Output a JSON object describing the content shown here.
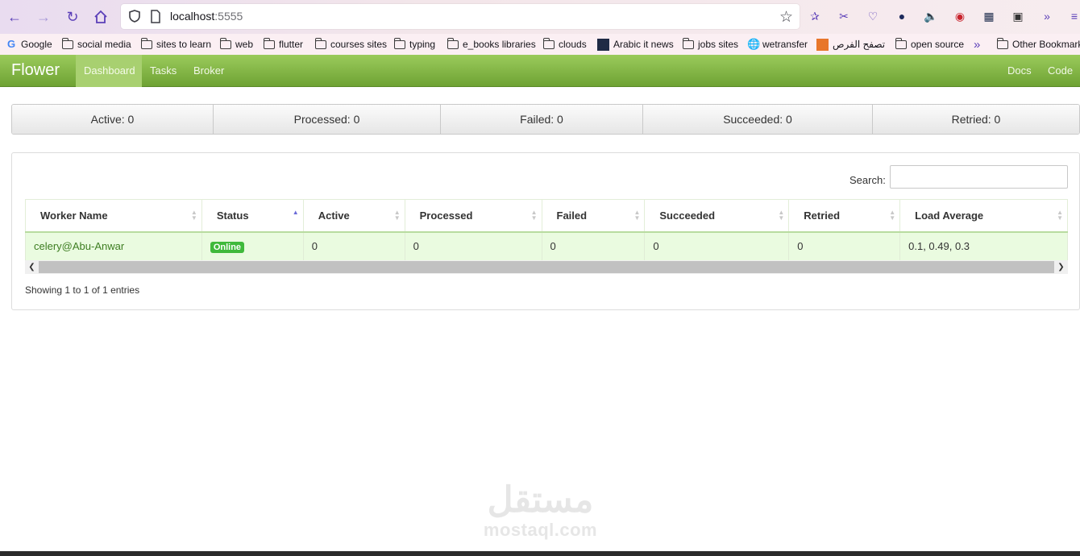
{
  "browser": {
    "url_host": "localhost",
    "url_port": ":5555",
    "bookmarks": [
      {
        "label": "Google",
        "icon": "google-icon"
      },
      {
        "label": "social media",
        "icon": "folder-icon"
      },
      {
        "label": "sites to learn",
        "icon": "folder-icon"
      },
      {
        "label": "web",
        "icon": "folder-icon"
      },
      {
        "label": "flutter",
        "icon": "folder-icon"
      },
      {
        "label": "courses sites",
        "icon": "folder-icon"
      },
      {
        "label": "typing",
        "icon": "folder-icon"
      },
      {
        "label": "e_books libraries",
        "icon": "folder-icon"
      },
      {
        "label": "clouds",
        "icon": "folder-icon"
      },
      {
        "label": "Arabic it news",
        "icon": "site-icon"
      },
      {
        "label": "jobs sites",
        "icon": "folder-icon"
      },
      {
        "label": "wetransfer",
        "icon": "globe-icon"
      },
      {
        "label": "تصفح الفرص",
        "icon": "site-icon"
      },
      {
        "label": "open source",
        "icon": "folder-icon"
      }
    ],
    "other_bookmarks": "Other Bookmarks"
  },
  "navbar": {
    "brand": "Flower",
    "items": [
      "Dashboard",
      "Tasks",
      "Broker"
    ],
    "active": "Dashboard",
    "right_items": [
      "Docs",
      "Code"
    ]
  },
  "stats": [
    {
      "label": "Active: 0"
    },
    {
      "label": "Processed: 0"
    },
    {
      "label": "Failed: 0"
    },
    {
      "label": "Succeeded: 0"
    },
    {
      "label": "Retried: 0"
    }
  ],
  "workers": {
    "search_label": "Search:",
    "search_value": "",
    "columns": [
      "Worker Name",
      "Status",
      "Active",
      "Processed",
      "Failed",
      "Succeeded",
      "Retried",
      "Load Average"
    ],
    "sorted_column": "Status",
    "rows": [
      {
        "worker_name": "celery@Abu-Anwar",
        "status": "Online",
        "active": "0",
        "processed": "0",
        "failed": "0",
        "succeeded": "0",
        "retried": "0",
        "load_average": "0.1, 0.49, 0.3"
      }
    ],
    "info": "Showing 1 to 1 of 1 entries"
  },
  "watermark": {
    "arabic": "مستقل",
    "latin": "mostaql.com"
  },
  "colors": {
    "navbar_top": "#9bcb5c",
    "navbar_bottom": "#6ea233",
    "row_bg": "#eafbe0",
    "online_badge": "#3fb93b",
    "worker_link": "#3d7d21"
  }
}
